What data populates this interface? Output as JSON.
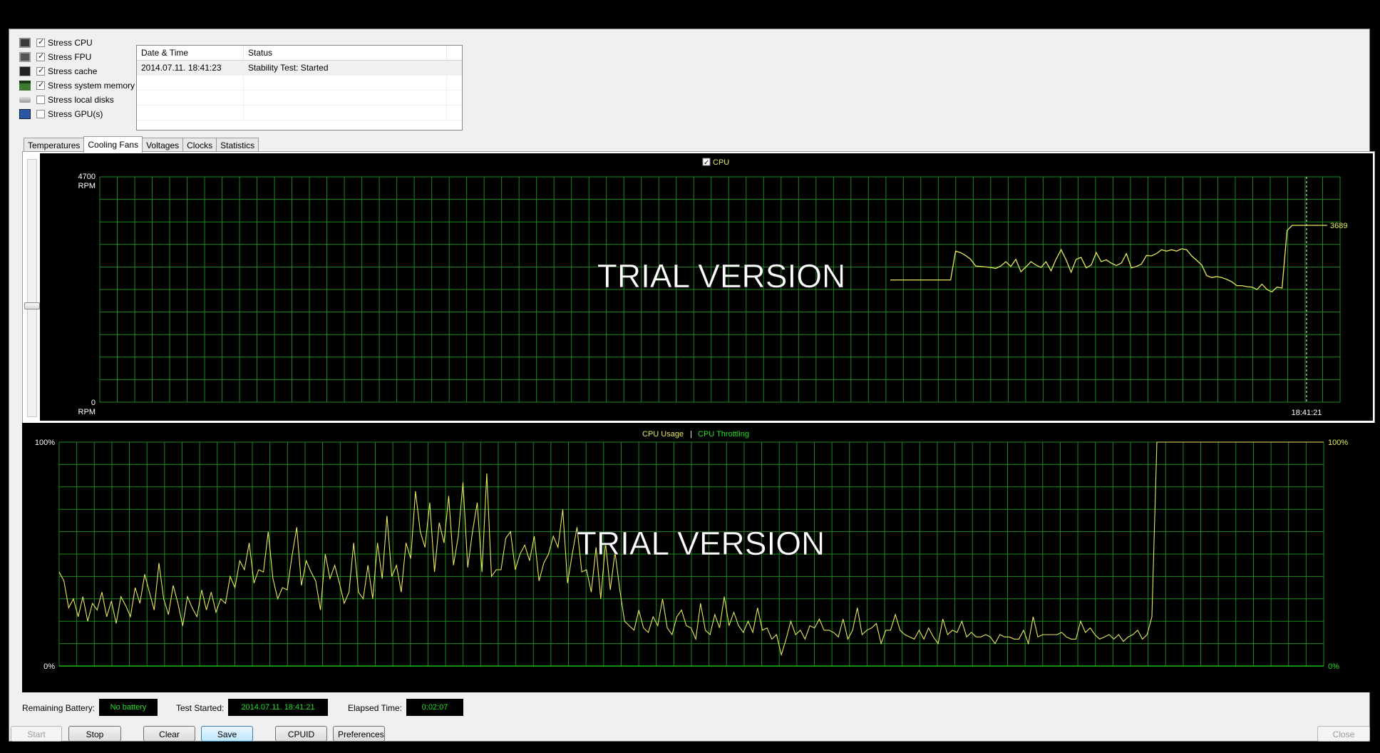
{
  "stress_options": [
    {
      "label": "Stress CPU",
      "checked": true,
      "icon": "cpu-icon"
    },
    {
      "label": "Stress FPU",
      "checked": true,
      "icon": "fpu-icon"
    },
    {
      "label": "Stress cache",
      "checked": true,
      "icon": "cache-icon"
    },
    {
      "label": "Stress system memory",
      "checked": true,
      "icon": "memory-icon"
    },
    {
      "label": "Stress local disks",
      "checked": false,
      "icon": "disk-icon"
    },
    {
      "label": "Stress GPU(s)",
      "checked": false,
      "icon": "gpu-icon"
    }
  ],
  "log": {
    "columns": [
      "Date & Time",
      "Status"
    ],
    "rows": [
      {
        "datetime": "2014.07.11. 18:41:23",
        "status": "Stability Test: Started"
      }
    ]
  },
  "tabs": [
    {
      "label": "Temperatures",
      "active": false
    },
    {
      "label": "Cooling Fans",
      "active": true
    },
    {
      "label": "Voltages",
      "active": false
    },
    {
      "label": "Clocks",
      "active": false
    },
    {
      "label": "Statistics",
      "active": false
    }
  ],
  "watermark": "TRIAL VERSION",
  "colors": {
    "series_yellow": "#e8e860",
    "series_green": "#20e020",
    "grid": "#1a8a1a",
    "axis_text": "#ffffff"
  },
  "chart_data": [
    {
      "type": "line",
      "legend": [
        {
          "name": "CPU",
          "checked": true
        }
      ],
      "ylim": [
        0,
        4700
      ],
      "ytick_labels": {
        "top": "4700",
        "top_unit": "RPM",
        "bottom": "0",
        "bottom_unit": "RPM"
      },
      "x_time_label": "18:41:21",
      "current_value_label": "3689",
      "series": [
        {
          "name": "CPU",
          "values": [
            2550,
            2550,
            2550,
            2550,
            2550,
            2550,
            2550,
            2550,
            2550,
            2550,
            2550,
            2550,
            2550,
            3150,
            3120,
            3060,
            2980,
            2840,
            2830,
            2820,
            2810,
            2790,
            2840,
            2930,
            2830,
            2980,
            2720,
            2820,
            2930,
            2860,
            2810,
            2930,
            2740,
            2980,
            3180,
            2970,
            2710,
            2980,
            3020,
            2800,
            2860,
            3120,
            2930,
            2970,
            2900,
            2850,
            2900,
            3100,
            2800,
            2830,
            2880,
            3060,
            3050,
            3100,
            3180,
            3150,
            3180,
            3150,
            3200,
            3180,
            3050,
            2960,
            2860,
            2640,
            2600,
            2620,
            2600,
            2560,
            2510,
            2430,
            2430,
            2410,
            2400,
            2350,
            2460,
            2350,
            2300,
            2400,
            2380,
            3580,
            3689,
            3689,
            3689,
            3689,
            3689,
            3689,
            3689,
            3689
          ]
        }
      ]
    },
    {
      "type": "line",
      "legend": [
        {
          "name": "CPU Usage"
        },
        {
          "name": "CPU Throttling"
        }
      ],
      "ylim": [
        0,
        100
      ],
      "ytick_labels": {
        "left_top": "100%",
        "left_bottom": "0%",
        "right_top": "100%",
        "right_bottom": "0%"
      },
      "series": [
        {
          "name": "CPU Usage",
          "values": [
            42,
            38,
            26,
            30,
            22,
            31,
            20,
            28,
            25,
            33,
            22,
            29,
            19,
            31,
            27,
            22,
            35,
            28,
            41,
            33,
            25,
            46,
            30,
            23,
            36,
            28,
            18,
            31,
            26,
            22,
            34,
            25,
            33,
            24,
            30,
            28,
            40,
            35,
            47,
            43,
            55,
            37,
            43,
            42,
            60,
            39,
            30,
            35,
            34,
            49,
            62,
            36,
            47,
            42,
            38,
            25,
            50,
            39,
            45,
            37,
            28,
            33,
            55,
            33,
            30,
            45,
            30,
            55,
            39,
            67,
            40,
            45,
            33,
            55,
            48,
            78,
            60,
            53,
            73,
            42,
            64,
            55,
            76,
            45,
            58,
            82,
            44,
            60,
            73,
            42,
            86,
            40,
            43,
            43,
            57,
            60,
            43,
            50,
            54,
            47,
            58,
            38,
            46,
            50,
            58,
            53,
            70,
            37,
            50,
            62,
            42,
            43,
            33,
            53,
            30,
            55,
            34,
            51,
            34,
            20,
            18,
            16,
            25,
            17,
            15,
            22,
            18,
            30,
            17,
            14,
            22,
            25,
            18,
            17,
            12,
            28,
            16,
            14,
            23,
            17,
            31,
            18,
            24,
            18,
            15,
            20,
            15,
            26,
            16,
            17,
            12,
            14,
            5,
            12,
            20,
            14,
            16,
            12,
            18,
            17,
            21,
            16,
            16,
            15,
            13,
            21,
            12,
            16,
            26,
            14,
            16,
            17,
            19,
            10,
            16,
            16,
            23,
            16,
            14,
            13,
            12,
            16,
            12,
            17,
            13,
            10,
            21,
            14,
            16,
            15,
            20,
            13,
            15,
            13,
            13,
            14,
            13,
            10,
            14,
            13,
            13,
            12,
            12,
            16,
            10,
            22,
            13,
            14,
            14,
            14,
            14,
            15,
            13,
            12,
            12,
            20,
            15,
            17,
            14,
            12,
            13,
            14,
            12,
            14,
            11,
            13,
            14,
            16,
            12,
            14,
            22
          ]
        },
        {
          "name": "CPU Throttling",
          "values": [
            0
          ]
        }
      ]
    }
  ],
  "status_bar": {
    "remaining_battery_label": "Remaining Battery:",
    "remaining_battery_value": "No battery",
    "test_started_label": "Test Started:",
    "test_started_value": "2014.07.11. 18:41:21",
    "elapsed_label": "Elapsed Time:",
    "elapsed_value": "0:02:07"
  },
  "buttons": {
    "start": "Start",
    "stop": "Stop",
    "clear": "Clear",
    "save": "Save",
    "cpuid": "CPUID",
    "preferences": "Preferences",
    "close": "Close"
  }
}
